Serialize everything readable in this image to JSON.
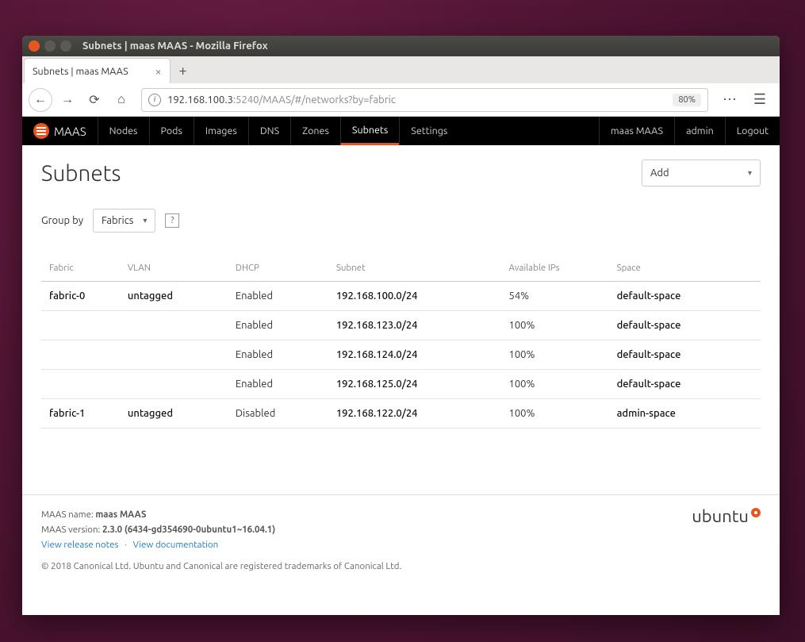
{
  "window": {
    "title": "Subnets | maas MAAS - Mozilla Firefox"
  },
  "tab": {
    "label": "Subnets | maas MAAS"
  },
  "urlbar": {
    "host": "192.168.100.3",
    "rest": ":5240/MAAS/#/networks?by=fabric",
    "zoom": "80%"
  },
  "maasNav": {
    "brand": "MAAS",
    "items": [
      "Nodes",
      "Pods",
      "Images",
      "DNS",
      "Zones",
      "Subnets",
      "Settings"
    ],
    "activeIndex": 5,
    "org": "maas MAAS",
    "user": "admin",
    "logout": "Logout"
  },
  "page": {
    "title": "Subnets",
    "addLabel": "Add",
    "groupByLabel": "Group by",
    "groupByValue": "Fabrics"
  },
  "table": {
    "headers": [
      "Fabric",
      "VLAN",
      "DHCP",
      "Subnet",
      "Available IPs",
      "Space"
    ],
    "rows": [
      {
        "fabric": "fabric-0",
        "vlan": "untagged",
        "dhcp": "Enabled",
        "subnet": "192.168.100.0/24",
        "avail": "54%",
        "space": "default-space"
      },
      {
        "fabric": "",
        "vlan": "",
        "dhcp": "Enabled",
        "subnet": "192.168.123.0/24",
        "avail": "100%",
        "space": "default-space"
      },
      {
        "fabric": "",
        "vlan": "",
        "dhcp": "Enabled",
        "subnet": "192.168.124.0/24",
        "avail": "100%",
        "space": "default-space"
      },
      {
        "fabric": "",
        "vlan": "",
        "dhcp": "Enabled",
        "subnet": "192.168.125.0/24",
        "avail": "100%",
        "space": "default-space"
      },
      {
        "fabric": "fabric-1",
        "vlan": "untagged",
        "dhcp": "Disabled",
        "subnet": "192.168.122.0/24",
        "avail": "100%",
        "space": "admin-space"
      }
    ]
  },
  "footer": {
    "nameLabel": "MAAS name:",
    "nameValue": "maas MAAS",
    "versionLabel": "MAAS version:",
    "versionValue": "2.3.0 (6434-gd354690-0ubuntu1~16.04.1)",
    "releaseNotes": "View release notes",
    "documentation": "View documentation",
    "copyright": "© 2018 Canonical Ltd. Ubuntu and Canonical are registered trademarks of Canonical Ltd.",
    "ubuntu": "ubuntu"
  }
}
